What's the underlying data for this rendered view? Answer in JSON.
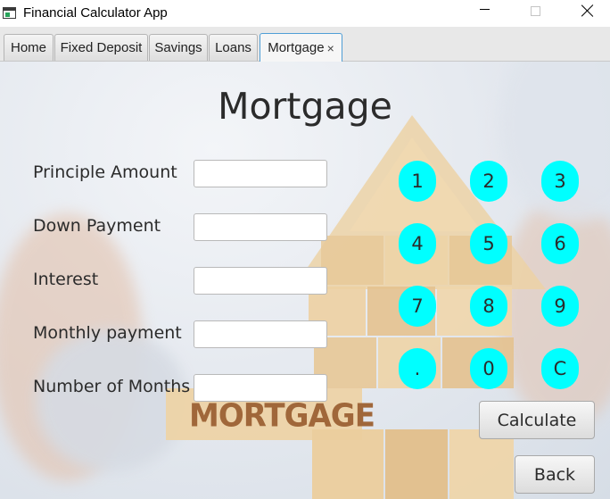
{
  "window": {
    "title": "Financial Calculator App"
  },
  "tabs": [
    {
      "label": "Home",
      "active": false
    },
    {
      "label": "Fixed Deposit",
      "active": false
    },
    {
      "label": "Savings",
      "active": false
    },
    {
      "label": "Loans",
      "active": false
    },
    {
      "label": "Mortgage",
      "active": true,
      "close_glyph": "×"
    }
  ],
  "page": {
    "title": "Mortgage",
    "background_sign": "MORTGAGE"
  },
  "form": {
    "fields": [
      {
        "label": "Principle Amount",
        "value": ""
      },
      {
        "label": "Down Payment",
        "value": ""
      },
      {
        "label": "Interest",
        "value": ""
      },
      {
        "label": "Monthly payment",
        "value": ""
      },
      {
        "label": "Number of Months",
        "value": ""
      }
    ]
  },
  "keypad": {
    "keys": [
      "1",
      "2",
      "3",
      "4",
      "5",
      "6",
      "7",
      "8",
      "9",
      ".",
      "0",
      "C"
    ],
    "color": "#00ffff"
  },
  "actions": {
    "calculate_label": "Calculate",
    "back_label": "Back"
  }
}
